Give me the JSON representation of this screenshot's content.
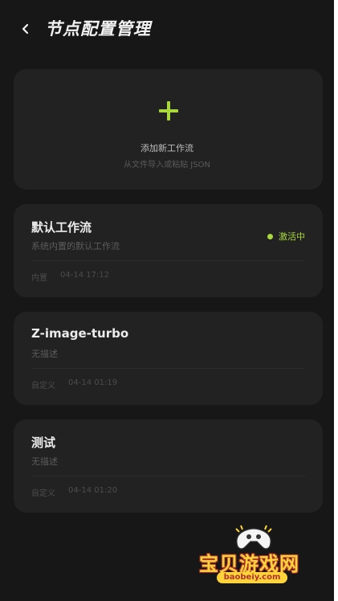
{
  "header": {
    "back_label": "<",
    "title": "节点配置管理"
  },
  "add_card": {
    "title": "添加新工作流",
    "subtitle": "从文件导入或粘贴 JSON",
    "accent": "#a8d83c"
  },
  "workflows": [
    {
      "name": "默认工作流",
      "description": "系统内置的默认工作流",
      "type": "内置",
      "date": "04-14 17:12",
      "status": "激活中"
    },
    {
      "name": "Z-image-turbo",
      "description": "无描述",
      "type": "自定义",
      "date": "04-14 01:19"
    },
    {
      "name": "测试",
      "description": "无描述",
      "type": "自定义",
      "date": "04-14 01:20"
    }
  ],
  "watermark": {
    "title": "宝贝游戏网",
    "url": "baobeiy.com",
    "icon": "gamepad-icon"
  }
}
